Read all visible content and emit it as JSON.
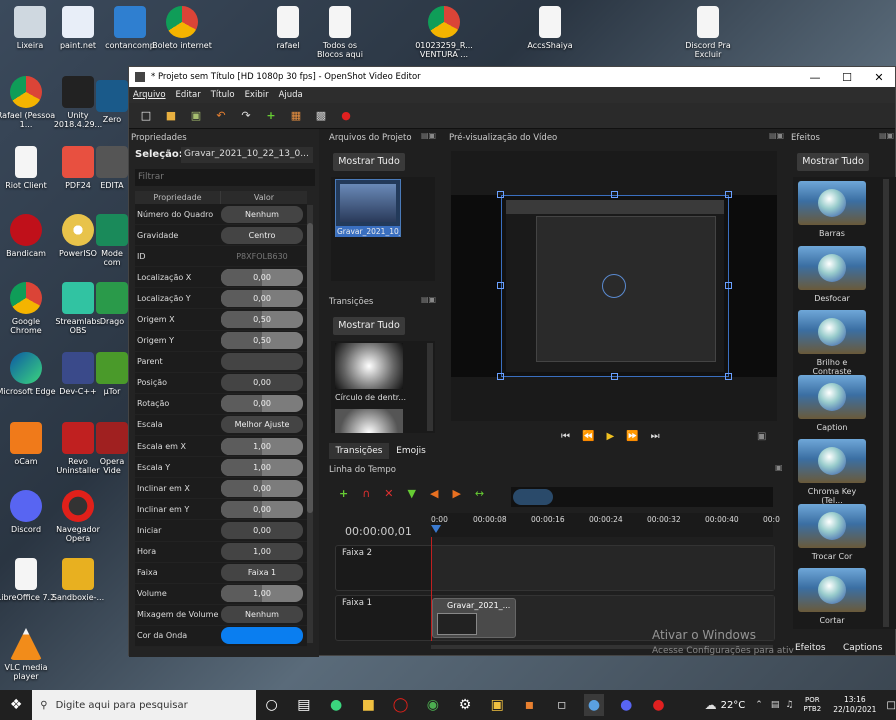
{
  "desktop": {
    "icons_top": [
      "Lixeira",
      "paint.net",
      "contancomp",
      "Boleto internet",
      "rafael",
      "Todos os Blocos aqui",
      "01023259_R... VENTURA ...",
      "AccsShaiya",
      "Discord Pra Excluir"
    ],
    "icons_left": [
      "Rafael (Pessoa 1...",
      "Riot Client",
      "Bandicam",
      "Google Chrome",
      "Microsoft Edge",
      "oCam",
      "Discord",
      "LibreOffice 7.2",
      "VLC media player"
    ],
    "icons_col2": [
      "Unity 2018.4.29...",
      "PDF24",
      "PowerISO",
      "Streamlabs OBS",
      "Dev-C++",
      "Revo Uninstaller",
      "Navegador Opera",
      "Sandboxie-..."
    ],
    "icons_col3": [
      "Zero",
      "EDITA",
      "Mode com",
      "Drago",
      "µTor",
      "Opera Vide",
      "",
      ""
    ],
    "watermark_title": "Ativar o Windows",
    "watermark_sub": "Acesse Configurações para ativ"
  },
  "window": {
    "title": "* Projeto sem Título [HD 1080p 30 fps] - OpenShot Video Editor",
    "controls": [
      "—",
      "☐",
      "✕"
    ]
  },
  "menu": [
    "Arquivo",
    "Editar",
    "Título",
    "Exibir",
    "Ajuda"
  ],
  "toolbar_icons": [
    "new-file",
    "open-folder",
    "save",
    "undo",
    "redo",
    "add",
    "film",
    "export",
    "record"
  ],
  "properties": {
    "header": "Propriedades",
    "selection_label": "Seleção:",
    "selection_value": "Gravar_2021_10_22_13_0...",
    "filter_placeholder": "Filtrar",
    "col_prop": "Propriedade",
    "col_val": "Valor",
    "rows": [
      {
        "k": "Número do Quadro",
        "v": "Nenhum",
        "style": "plain"
      },
      {
        "k": "Gravidade",
        "v": "Centro",
        "style": "plain"
      },
      {
        "k": "ID",
        "v": "P8XFOLB630",
        "style": "dim"
      },
      {
        "k": "Localização X",
        "v": "0,00",
        "style": "slider"
      },
      {
        "k": "Localização Y",
        "v": "0,00",
        "style": "slider"
      },
      {
        "k": "Origem X",
        "v": "0,50",
        "style": "slider"
      },
      {
        "k": "Origem Y",
        "v": "0,50",
        "style": "slider"
      },
      {
        "k": "Parent",
        "v": "",
        "style": "plain"
      },
      {
        "k": "Posição",
        "v": "0,00",
        "style": "plain"
      },
      {
        "k": "Rotação",
        "v": "0,00",
        "style": "slider"
      },
      {
        "k": "Escala",
        "v": "Melhor Ajuste",
        "style": "plain"
      },
      {
        "k": "Escala em X",
        "v": "1,00",
        "style": "slider"
      },
      {
        "k": "Escala Y",
        "v": "1,00",
        "style": "slider"
      },
      {
        "k": "Inclinar em X",
        "v": "0,00",
        "style": "slider"
      },
      {
        "k": "Inclinar em Y",
        "v": "0,00",
        "style": "slider"
      },
      {
        "k": "Iniciar",
        "v": "0,00",
        "style": "plain"
      },
      {
        "k": "Hora",
        "v": "1,00",
        "style": "plain"
      },
      {
        "k": "Faixa",
        "v": "Faixa 1",
        "style": "plain"
      },
      {
        "k": "Volume",
        "v": "1,00",
        "style": "slider"
      },
      {
        "k": "Mixagem de Volume",
        "v": "Nenhum",
        "style": "plain"
      },
      {
        "k": "Cor da Onda",
        "v": "",
        "style": "color"
      }
    ]
  },
  "project_files": {
    "header": "Arquivos do Projeto",
    "show_all": "Mostrar Tudo",
    "file_name": "Gravar_2021_10_..."
  },
  "transitions": {
    "header": "Transições",
    "show_all": "Mostrar Tudo",
    "item": "Círculo de dentr..."
  },
  "tabs": [
    "Transições",
    "Emojis"
  ],
  "preview": {
    "header": "Pré-visualização do Vídeo"
  },
  "timeline": {
    "header": "Linha do Tempo",
    "timecode": "00:00:00,01",
    "ruler": [
      "0:00",
      "00:00:08",
      "00:00:16",
      "00:00:24",
      "00:00:32",
      "00:00:40",
      "00:0"
    ],
    "tracks": [
      "Faixa 2",
      "Faixa 1"
    ],
    "clip_name": "Gravar_2021_..."
  },
  "effects": {
    "header": "Efeitos",
    "show_all": "Mostrar Tudo",
    "items": [
      "Barras",
      "Desfocar",
      "Brilho e Contraste",
      "Caption",
      "Chroma Key (Tel...",
      "Trocar Cor",
      "Cortar"
    ],
    "tab_effects": "Efeitos",
    "tab_captions": "Captions"
  },
  "taskbar": {
    "search_placeholder": "Digite aqui para pesquisar",
    "temperature": "22°C",
    "lang": "POR",
    "layout": "PTB2",
    "time": "13:16",
    "date": "22/10/2021"
  }
}
